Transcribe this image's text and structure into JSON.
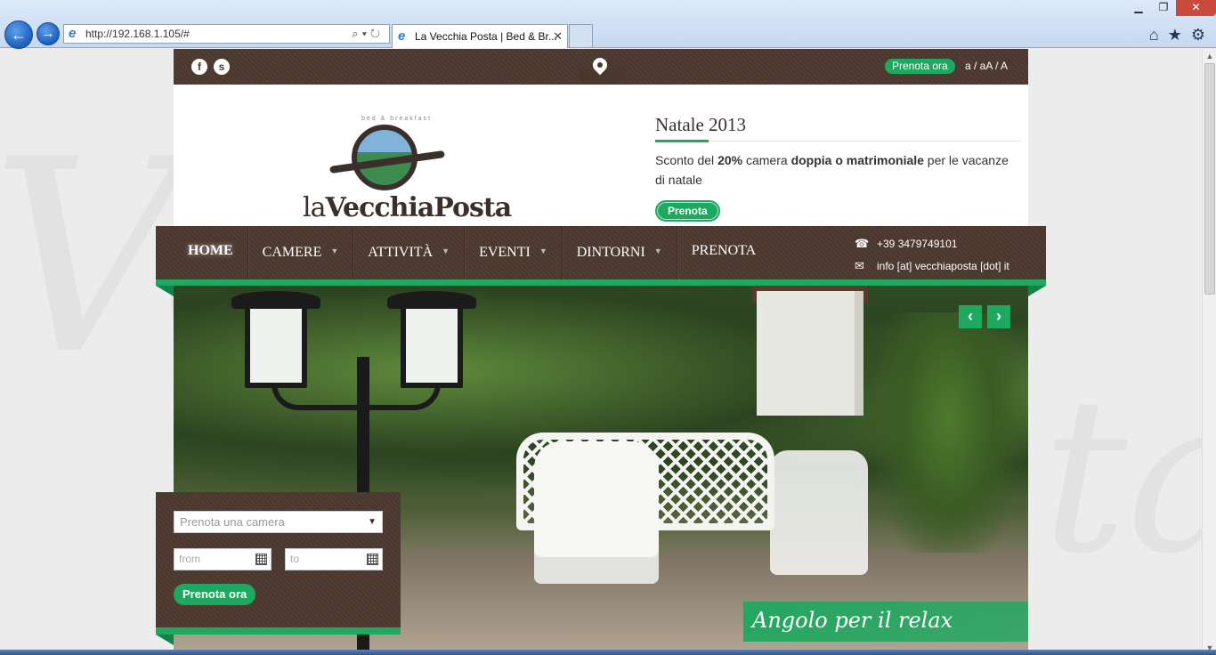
{
  "browser": {
    "url": "http://192.168.1.105/#",
    "tab_title": "La Vecchia Posta | Bed & Br...",
    "window_buttons": {
      "minimize": "▁",
      "maximize": "❐",
      "close": "✕"
    }
  },
  "site": {
    "topbar": {
      "social": [
        {
          "icon": "facebook-icon",
          "glyph": "f"
        },
        {
          "icon": "skype-icon",
          "glyph": "s"
        }
      ],
      "book_now": "Prenota ora",
      "font_size": "a / aA / A"
    },
    "logo": {
      "prefix": "la",
      "name": "VecchiaPosta",
      "tagline": "bed & breakfast"
    },
    "news": {
      "title": "Natale 2013",
      "text_1": "Sconto del ",
      "text_2": "20%",
      "text_3": " camera ",
      "text_4": "doppia o matrimoniale",
      "text_5": " per le vacanze di natale",
      "button": "Prenota"
    },
    "nav": {
      "items": [
        {
          "label": "HOME",
          "dropdown": false
        },
        {
          "label": "CAMERE",
          "dropdown": true
        },
        {
          "label": "ATTIVITÀ",
          "dropdown": true
        },
        {
          "label": "EVENTI",
          "dropdown": true
        },
        {
          "label": "DINTORNI",
          "dropdown": true
        },
        {
          "label": "PRENOTA",
          "dropdown": false
        }
      ]
    },
    "contact": {
      "phone": "+39 3479749101",
      "email": "info [at] vecchiaposta [dot] it"
    },
    "slider": {
      "caption": "Angolo per il relax",
      "prev": "‹",
      "next": "›"
    },
    "booking": {
      "select_placeholder": "Prenota una camera",
      "from_placeholder": "from",
      "to_placeholder": "to",
      "button": "Prenota ora"
    }
  },
  "colors": {
    "brand_brown": "#4a372e",
    "accent_green": "#1fa85f"
  }
}
